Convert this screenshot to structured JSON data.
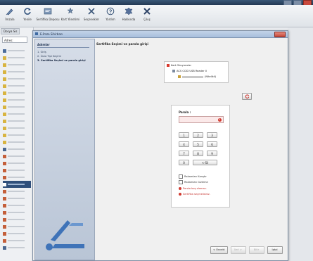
{
  "toolbar": {
    "items": [
      {
        "label": "İmzala"
      },
      {
        "label": "Yenile"
      },
      {
        "label": "Sertifika Deposu"
      },
      {
        "label": "Kart Yönetimi"
      },
      {
        "label": "Seçenekler"
      },
      {
        "label": "Yardım"
      },
      {
        "label": "Hakkında"
      },
      {
        "label": "Çıkış"
      }
    ]
  },
  "left_panel": {
    "tab": "Dosya Sis",
    "search": "Adres:"
  },
  "dialog": {
    "title": "E-İmza Sihirbazı",
    "sidebar": {
      "heading": "Adımlar",
      "steps": [
        "1. Giriş",
        "2. İmza Tipi Seçimi",
        "3. Sertifika Seçimi ve parola girişi"
      ],
      "current_step": 2
    },
    "main_title": "Sertifika Seçimi ve parola girişi",
    "tree": {
      "root": "Kart Okuyucular",
      "reader": "ACS CCID USB Reader 0",
      "certificate_suffix": "(Nitelikli)"
    },
    "pin": {
      "label": "Parola :",
      "warning_glyph": "!",
      "keys": [
        "1",
        "2",
        "3",
        "4",
        "5",
        "6",
        "7",
        "8",
        "9",
        "0",
        "<-Sil"
      ]
    },
    "options": [
      {
        "label": "Rakamları Karıştır"
      },
      {
        "label": "Rakamları Gizleme"
      }
    ],
    "errors": [
      {
        "text": "Parola boş olamaz."
      },
      {
        "text": "Sertifika seçmelisiniz."
      }
    ],
    "buttons": {
      "back": "< Önceki",
      "next": "İleri >",
      "finish": "Bitir",
      "cancel": "İptal"
    }
  },
  "colors": {
    "accent": "#2f4f7b",
    "error": "#c4302b",
    "pin_invalid_bg": "#fbe9e9"
  }
}
